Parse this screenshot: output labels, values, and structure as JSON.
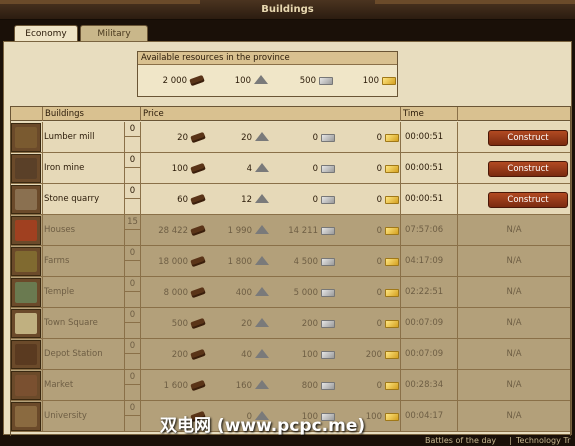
{
  "window": {
    "title": "Buildings"
  },
  "tabs": [
    {
      "label": "Economy",
      "active": true
    },
    {
      "label": "Military",
      "active": false
    }
  ],
  "resources": {
    "title": "Available resources in the province",
    "items": [
      {
        "value": "2 000",
        "icon": "wood-icon"
      },
      {
        "value": "100",
        "icon": "stone-icon"
      },
      {
        "value": "500",
        "icon": "iron-icon"
      },
      {
        "value": "100",
        "icon": "gold-icon"
      }
    ]
  },
  "table": {
    "headers": {
      "buildings": "Buildings",
      "price": "Price",
      "time": "Time"
    },
    "construct_label": "Construct",
    "na_label": "N/A",
    "rows": [
      {
        "name": "Lumber mill",
        "level": "0",
        "extra": "",
        "wood": "20",
        "stone": "20",
        "iron": "0",
        "gold": "0",
        "time": "00:00:51",
        "available": true,
        "color": "#7a5a30"
      },
      {
        "name": "Iron mine",
        "level": "0",
        "extra": "",
        "wood": "100",
        "stone": "4",
        "iron": "0",
        "gold": "0",
        "time": "00:00:51",
        "available": true,
        "color": "#5a4028"
      },
      {
        "name": "Stone quarry",
        "level": "0",
        "extra": "",
        "wood": "60",
        "stone": "12",
        "iron": "0",
        "gold": "0",
        "time": "00:00:51",
        "available": true,
        "color": "#8a7050"
      },
      {
        "name": "Houses",
        "level": "15",
        "extra": "",
        "wood": "28 422",
        "stone": "1 990",
        "iron": "14 211",
        "gold": "0",
        "time": "07:57:06",
        "available": false,
        "color": "#a04020"
      },
      {
        "name": "Farms",
        "level": "0",
        "extra": "",
        "wood": "18 000",
        "stone": "1 800",
        "iron": "4 500",
        "gold": "0",
        "time": "04:17:09",
        "available": false,
        "color": "#806a30"
      },
      {
        "name": "Temple",
        "level": "0",
        "extra": "",
        "wood": "8 000",
        "stone": "400",
        "iron": "5 000",
        "gold": "0",
        "time": "02:22:51",
        "available": false,
        "color": "#6a7a50"
      },
      {
        "name": "Town Square",
        "level": "0",
        "extra": "",
        "wood": "500",
        "stone": "20",
        "iron": "200",
        "gold": "0",
        "time": "00:07:09",
        "available": false,
        "color": "#c0b080"
      },
      {
        "name": "Depot Station",
        "level": "0",
        "extra": "",
        "wood": "200",
        "stone": "40",
        "iron": "100",
        "gold": "200",
        "time": "00:07:09",
        "available": false,
        "color": "#5a3a20"
      },
      {
        "name": "Market",
        "level": "0",
        "extra": "",
        "wood": "1 600",
        "stone": "160",
        "iron": "800",
        "gold": "0",
        "time": "00:28:34",
        "available": false,
        "color": "#7a5030"
      },
      {
        "name": "University",
        "level": "0",
        "extra": "",
        "wood": "",
        "stone": "0",
        "iron": "100",
        "gold": "100",
        "time": "00:04:17",
        "available": false,
        "color": "#8a6a40"
      }
    ]
  },
  "footer": {
    "link1": "Battles of the day",
    "separator": "|",
    "link2": "Technology Tr"
  },
  "watermark": "双电网 (www.pcpc.me)"
}
